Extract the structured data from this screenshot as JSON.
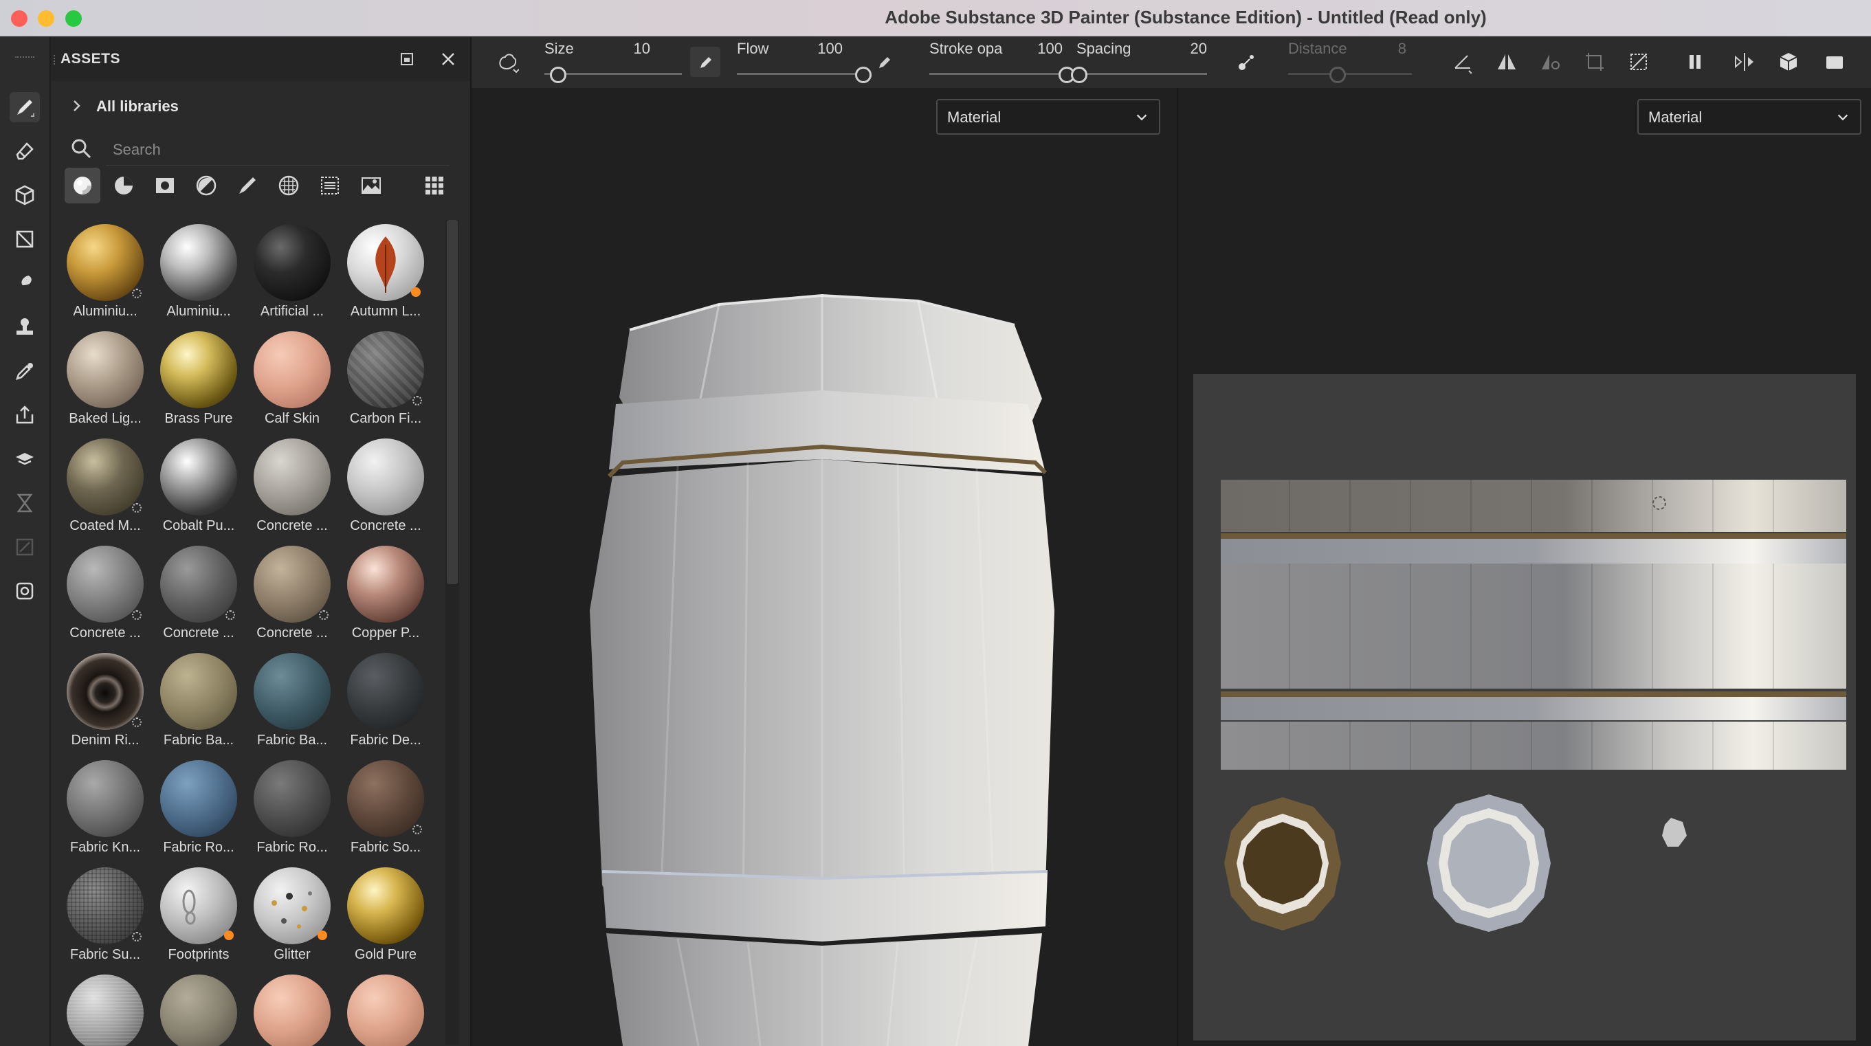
{
  "window": {
    "title": "Adobe Substance 3D Painter (Substance Edition) - Untitled (Read only)"
  },
  "colors": {
    "close": "#fe5f57",
    "minimize": "#febc2e",
    "maximize": "#28c840",
    "accent": "#ff8a1e"
  },
  "assets": {
    "title": "ASSETS",
    "breadcrumb": "All libraries",
    "search_placeholder": "Search",
    "filters": [
      "materials-icon",
      "smart-materials-icon",
      "masks-icon",
      "filters-icon",
      "brushes-icon",
      "textures-icon",
      "alphas-icon",
      "environments-icon",
      "grid-view-icon"
    ],
    "items": [
      {
        "label": "Aluminiu...",
        "badge": "generator"
      },
      {
        "label": "Aluminiu...",
        "badge": ""
      },
      {
        "label": "Artificial ...",
        "badge": ""
      },
      {
        "label": "Autumn L...",
        "badge": "smart"
      },
      {
        "label": "Baked Lig...",
        "badge": ""
      },
      {
        "label": "Brass Pure",
        "badge": ""
      },
      {
        "label": "Calf Skin",
        "badge": ""
      },
      {
        "label": "Carbon Fi...",
        "badge": "generator"
      },
      {
        "label": "Coated M...",
        "badge": "generator"
      },
      {
        "label": "Cobalt Pu...",
        "badge": ""
      },
      {
        "label": "Concrete ...",
        "badge": ""
      },
      {
        "label": "Concrete ...",
        "badge": ""
      },
      {
        "label": "Concrete ...",
        "badge": "generator"
      },
      {
        "label": "Concrete ...",
        "badge": "generator"
      },
      {
        "label": "Concrete ...",
        "badge": "generator"
      },
      {
        "label": "Copper P...",
        "badge": ""
      },
      {
        "label": "Denim Ri...",
        "badge": "generator"
      },
      {
        "label": "Fabric Ba...",
        "badge": ""
      },
      {
        "label": "Fabric Ba...",
        "badge": ""
      },
      {
        "label": "Fabric De...",
        "badge": ""
      },
      {
        "label": "Fabric Kn...",
        "badge": ""
      },
      {
        "label": "Fabric Ro...",
        "badge": ""
      },
      {
        "label": "Fabric Ro...",
        "badge": ""
      },
      {
        "label": "Fabric So...",
        "badge": "generator"
      },
      {
        "label": "Fabric Su...",
        "badge": "generator"
      },
      {
        "label": "Footprints",
        "badge": "smart"
      },
      {
        "label": "Glitter",
        "badge": "smart"
      },
      {
        "label": "Gold Pure",
        "badge": ""
      },
      {
        "label": "",
        "badge": ""
      },
      {
        "label": "",
        "badge": ""
      },
      {
        "label": "",
        "badge": ""
      },
      {
        "label": "",
        "badge": ""
      }
    ]
  },
  "toolbar": {
    "size_label": "Size",
    "size_value": "10",
    "size_level": 0.1,
    "flow_label": "Flow",
    "flow_value": "100",
    "flow_level": 1.0,
    "stroke_label": "Stroke opa",
    "stroke_value": "100",
    "stroke_level": 1.0,
    "spacing_label": "Spacing",
    "spacing_value": "20",
    "spacing_level": 0.02,
    "distance_label": "Distance",
    "distance_value": "8",
    "distance_level": 0.4
  },
  "viewport3d": {
    "channel": "Material"
  },
  "viewport2d": {
    "channel": "Material"
  }
}
